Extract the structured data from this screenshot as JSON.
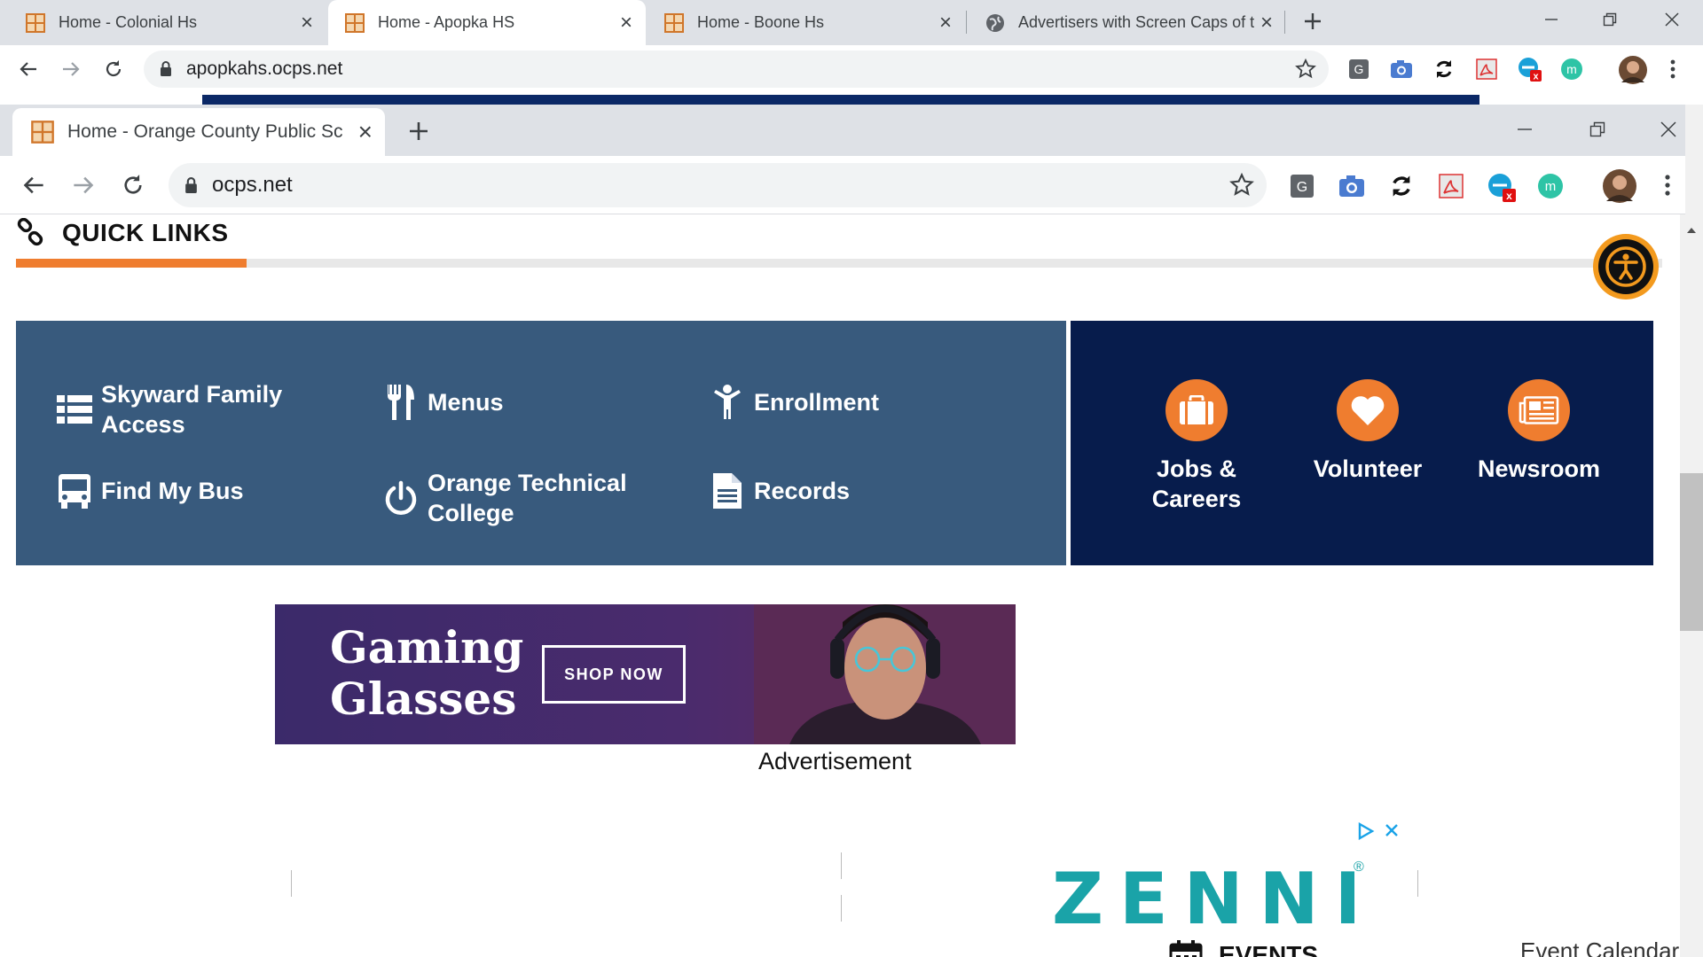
{
  "outer_window": {
    "tabs": [
      {
        "title": "Home - Colonial Hs"
      },
      {
        "title": "Home - Apopka HS"
      },
      {
        "title": "Home - Boone Hs"
      },
      {
        "title": "Advertisers with Screen Caps of t"
      }
    ],
    "url": "apopkahs.ocps.net"
  },
  "inner_window": {
    "tab_title": "Home - Orange County Public Sc",
    "url": "ocps.net"
  },
  "quick_links": {
    "heading": "QUICK LINKS",
    "progress_fraction": 0.14,
    "items": [
      {
        "label": "Skyward Family Access",
        "icon": "list-icon"
      },
      {
        "label": "Menus",
        "icon": "utensils-icon"
      },
      {
        "label": "Enrollment",
        "icon": "child-icon"
      },
      {
        "label": "Find My Bus",
        "icon": "bus-icon"
      },
      {
        "label": "Orange Technical College",
        "icon": "power-icon"
      },
      {
        "label": "Records",
        "icon": "document-icon"
      }
    ],
    "features": [
      {
        "label": "Jobs & Careers",
        "icon": "briefcase-icon"
      },
      {
        "label": "Volunteer",
        "icon": "heart-icon"
      },
      {
        "label": "Newsroom",
        "icon": "newspaper-icon"
      }
    ]
  },
  "ad": {
    "headline_line1": "Gaming",
    "headline_line2": "Glasses",
    "button": "SHOP NOW",
    "brand": "ZENNI",
    "reg_mark": "®",
    "label": "Advertisement"
  },
  "events": {
    "heading": "EVENTS",
    "calendar_link": "Event Calendar"
  },
  "colors": {
    "quick_links_panel": "#385a7d",
    "feature_panel": "#071c4c",
    "accent_orange": "#ef7d2f",
    "brand_teal": "#1aa3a8"
  }
}
